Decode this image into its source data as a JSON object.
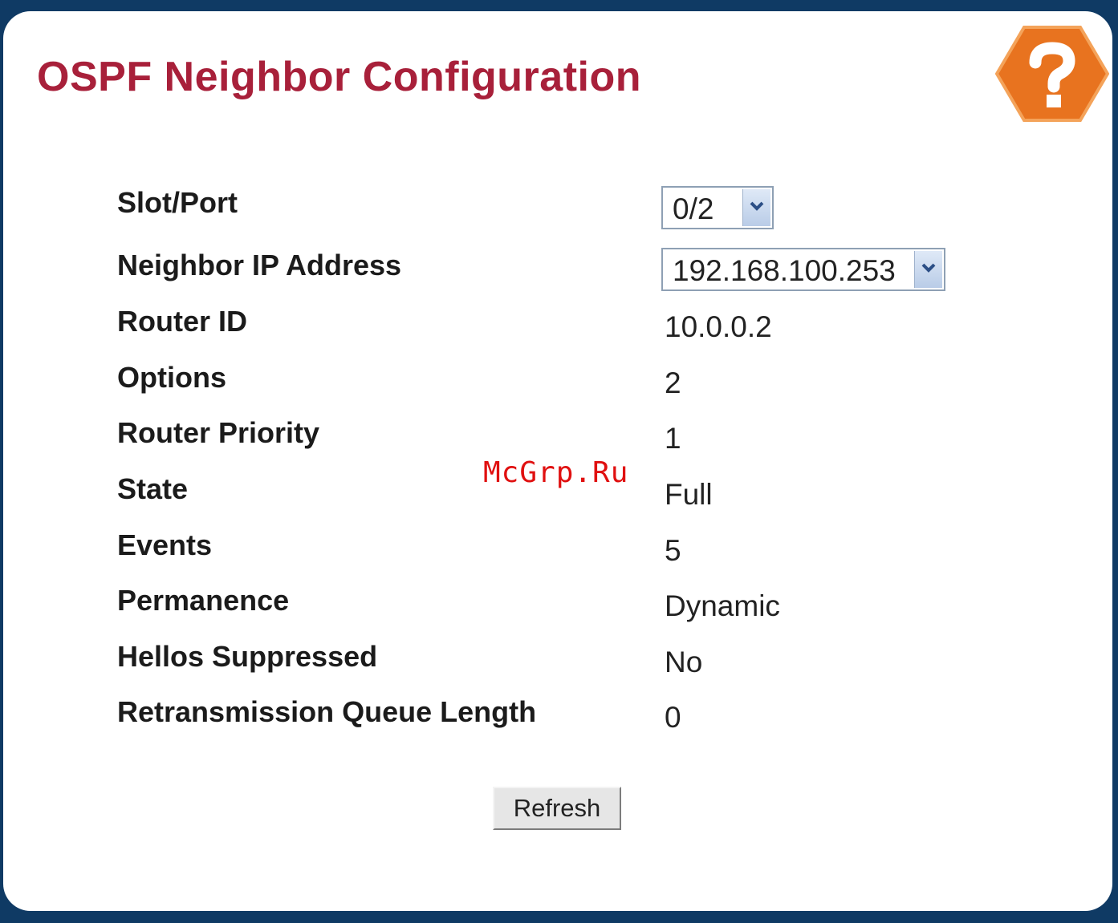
{
  "page": {
    "title": "OSPF Neighbor Configuration",
    "help_icon": "question-mark-hexagon-icon",
    "help_color": "#e8731f",
    "title_color": "#a8203a"
  },
  "fields": {
    "slot_port": {
      "label": "Slot/Port",
      "value": "0/2"
    },
    "neighbor_ip": {
      "label": "Neighbor IP Address",
      "value": "192.168.100.253"
    },
    "router_id": {
      "label": "Router ID",
      "value": "10.0.0.2"
    },
    "options": {
      "label": "Options",
      "value": "2"
    },
    "router_priority": {
      "label": "Router Priority",
      "value": "1"
    },
    "state": {
      "label": "State",
      "value": "Full"
    },
    "events": {
      "label": "Events",
      "value": "5"
    },
    "permanence": {
      "label": "Permanence",
      "value": "Dynamic"
    },
    "hellos_suppressed": {
      "label": "Hellos Suppressed",
      "value": "No"
    },
    "retransmission_queue_length": {
      "label": "Retransmission Queue Length",
      "value": "0"
    }
  },
  "actions": {
    "refresh_label": "Refresh"
  },
  "watermark": "McGrp.Ru"
}
